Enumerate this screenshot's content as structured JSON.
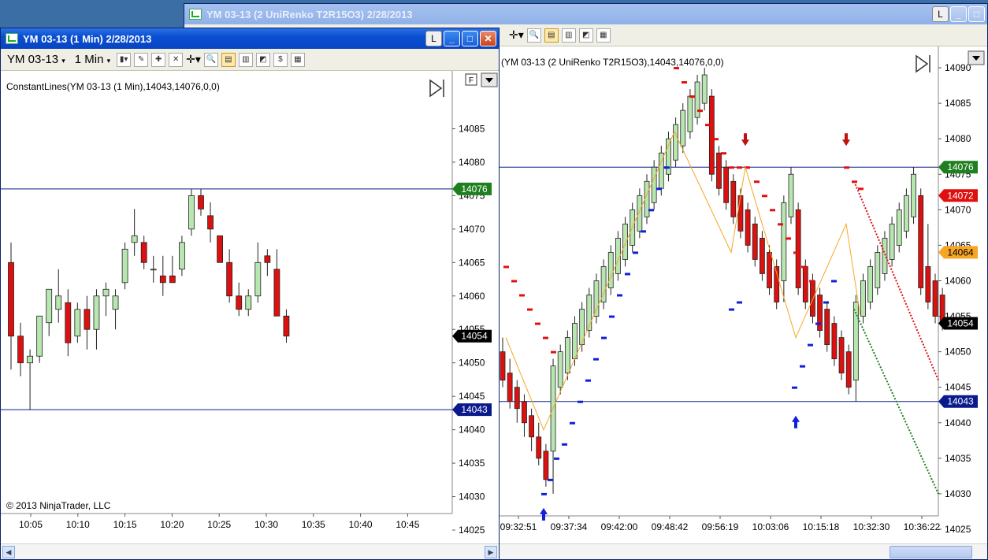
{
  "right_window": {
    "title": "YM 03-13 (2 UniRenko T2R15O3)  2/28/2013",
    "indicator_label": "(YM  03-13  (2  UniRenko  T2R15O3),14043,14076,0,0)",
    "y_ticks": [
      "14090",
      "14085",
      "14080",
      "14075",
      "14070",
      "14065",
      "14060",
      "14055",
      "14050",
      "14045",
      "14040",
      "14035",
      "14030",
      "14025"
    ],
    "x_ticks": [
      "09:32:51",
      "09:37:34",
      "09:42:00",
      "09:48:42",
      "09:56:19",
      "10:03:06",
      "10:15:18",
      "10:32:30",
      "10:36:22"
    ],
    "price_tags": [
      {
        "label": "14076",
        "value": 14076,
        "color": "#1e7f1e"
      },
      {
        "label": "14072",
        "value": 14072,
        "color": "#e01010"
      },
      {
        "label": "14064",
        "value": 14064,
        "color": "#f6a623"
      },
      {
        "label": "14054",
        "value": 14054,
        "color": "#000000"
      },
      {
        "label": "14043",
        "value": 14043,
        "color": "#0a1a8c"
      }
    ]
  },
  "left_window": {
    "title": "YM 03-13 (1 Min)  2/28/2013",
    "instrument": "YM 03-13",
    "interval": "1 Min",
    "indicator_label": "ConstantLines(YM  03-13  (1  Min),14043,14076,0,0)",
    "copyright": "© 2013 NinjaTrader, LLC",
    "y_ticks": [
      "14085",
      "14080",
      "14075",
      "14070",
      "14065",
      "14060",
      "14055",
      "14050",
      "14045",
      "14040",
      "14035",
      "14030",
      "14025"
    ],
    "x_ticks": [
      "10:05",
      "10:10",
      "10:15",
      "10:20",
      "10:25",
      "10:30",
      "10:35",
      "10:40",
      "10:45"
    ],
    "price_tags": [
      {
        "label": "14076",
        "value": 14076,
        "color": "#1e7f1e"
      },
      {
        "label": "14054",
        "value": 14054,
        "color": "#000000"
      },
      {
        "label": "14043",
        "value": 14043,
        "color": "#0a1a8c"
      }
    ]
  },
  "window_buttons": {
    "lock": "L",
    "minimize": "_",
    "maximize": "□",
    "close": "✕"
  },
  "chart_data": [
    {
      "type": "candlestick",
      "id": "left-1min",
      "ylim": [
        14023,
        14092
      ],
      "constant_lines": [
        14043,
        14076
      ],
      "candles": [
        {
          "o": 14065,
          "h": 14068,
          "l": 14049,
          "c": 14054
        },
        {
          "o": 14054,
          "h": 14056,
          "l": 14048,
          "c": 14050
        },
        {
          "o": 14050,
          "h": 14052,
          "l": 14043,
          "c": 14051
        },
        {
          "o": 14051,
          "h": 14057,
          "l": 14050,
          "c": 14057
        },
        {
          "o": 14056,
          "h": 14061,
          "l": 14054,
          "c": 14061
        },
        {
          "o": 14058,
          "h": 14064,
          "l": 14056,
          "c": 14060
        },
        {
          "o": 14059,
          "h": 14061,
          "l": 14051,
          "c": 14053
        },
        {
          "o": 14054,
          "h": 14059,
          "l": 14053,
          "c": 14058
        },
        {
          "o": 14058,
          "h": 14060,
          "l": 14052,
          "c": 14055
        },
        {
          "o": 14055,
          "h": 14061,
          "l": 14052,
          "c": 14060
        },
        {
          "o": 14060,
          "h": 14062,
          "l": 14057,
          "c": 14061
        },
        {
          "o": 14058,
          "h": 14061,
          "l": 14055,
          "c": 14060
        },
        {
          "o": 14062,
          "h": 14068,
          "l": 14061,
          "c": 14067
        },
        {
          "o": 14068,
          "h": 14073,
          "l": 14066,
          "c": 14069
        },
        {
          "o": 14068,
          "h": 14069,
          "l": 14064,
          "c": 14065
        },
        {
          "o": 14064,
          "h": 14066,
          "l": 14062,
          "c": 14064
        },
        {
          "o": 14063,
          "h": 14066,
          "l": 14060,
          "c": 14062
        },
        {
          "o": 14063,
          "h": 14066,
          "l": 14062,
          "c": 14062
        },
        {
          "o": 14064,
          "h": 14069,
          "l": 14063,
          "c": 14068
        },
        {
          "o": 14070,
          "h": 14076,
          "l": 14069,
          "c": 14075
        },
        {
          "o": 14075,
          "h": 14076,
          "l": 14072,
          "c": 14073
        },
        {
          "o": 14072,
          "h": 14074,
          "l": 14068,
          "c": 14070
        },
        {
          "o": 14069,
          "h": 14069,
          "l": 14065,
          "c": 14065
        },
        {
          "o": 14065,
          "h": 14067,
          "l": 14059,
          "c": 14060
        },
        {
          "o": 14060,
          "h": 14062,
          "l": 14057,
          "c": 14058
        },
        {
          "o": 14058,
          "h": 14061,
          "l": 14057,
          "c": 14060
        },
        {
          "o": 14060,
          "h": 14068,
          "l": 14059,
          "c": 14065
        },
        {
          "o": 14066,
          "h": 14067,
          "l": 14063,
          "c": 14065
        },
        {
          "o": 14064,
          "h": 14067,
          "l": 14057,
          "c": 14057
        },
        {
          "o": 14057,
          "h": 14058,
          "l": 14053,
          "c": 14054
        }
      ]
    },
    {
      "type": "candlestick",
      "id": "right-unirenko",
      "ylim": [
        14023,
        14093
      ],
      "constant_lines": [
        14043,
        14076
      ],
      "candles": [
        {
          "o": 14050,
          "h": 14052,
          "l": 14045,
          "c": 14046
        },
        {
          "o": 14047,
          "h": 14049,
          "l": 14042,
          "c": 14043
        },
        {
          "o": 14045,
          "h": 14046,
          "l": 14040,
          "c": 14042
        },
        {
          "o": 14043,
          "h": 14044,
          "l": 14038,
          "c": 14040
        },
        {
          "o": 14041,
          "h": 14042,
          "l": 14036,
          "c": 14038
        },
        {
          "o": 14038,
          "h": 14040,
          "l": 14034,
          "c": 14035
        },
        {
          "o": 14036,
          "h": 14037,
          "l": 14031,
          "c": 14032
        },
        {
          "o": 14036,
          "h": 14049,
          "l": 14030,
          "c": 14048
        },
        {
          "o": 14045,
          "h": 14051,
          "l": 14044,
          "c": 14050
        },
        {
          "o": 14047,
          "h": 14053,
          "l": 14046,
          "c": 14052
        },
        {
          "o": 14049,
          "h": 14055,
          "l": 14048,
          "c": 14054
        },
        {
          "o": 14051,
          "h": 14057,
          "l": 14050,
          "c": 14056
        },
        {
          "o": 14053,
          "h": 14059,
          "l": 14052,
          "c": 14058
        },
        {
          "o": 14055,
          "h": 14061,
          "l": 14054,
          "c": 14060
        },
        {
          "o": 14057,
          "h": 14063,
          "l": 14056,
          "c": 14062
        },
        {
          "o": 14059,
          "h": 14065,
          "l": 14058,
          "c": 14064
        },
        {
          "o": 14061,
          "h": 14067,
          "l": 14060,
          "c": 14066
        },
        {
          "o": 14063,
          "h": 14069,
          "l": 14062,
          "c": 14068
        },
        {
          "o": 14065,
          "h": 14071,
          "l": 14064,
          "c": 14070
        },
        {
          "o": 14067,
          "h": 14073,
          "l": 14066,
          "c": 14072
        },
        {
          "o": 14069,
          "h": 14075,
          "l": 14068,
          "c": 14074
        },
        {
          "o": 14071,
          "h": 14077,
          "l": 14070,
          "c": 14076
        },
        {
          "o": 14073,
          "h": 14079,
          "l": 14072,
          "c": 14078
        },
        {
          "o": 14075,
          "h": 14081,
          "l": 14074,
          "c": 14080
        },
        {
          "o": 14077,
          "h": 14083,
          "l": 14076,
          "c": 14082
        },
        {
          "o": 14079,
          "h": 14085,
          "l": 14078,
          "c": 14084
        },
        {
          "o": 14081,
          "h": 14087,
          "l": 14080,
          "c": 14086
        },
        {
          "o": 14083,
          "h": 14089,
          "l": 14082,
          "c": 14088
        },
        {
          "o": 14085,
          "h": 14090,
          "l": 14084,
          "c": 14089
        },
        {
          "o": 14086,
          "h": 14087,
          "l": 14074,
          "c": 14075
        },
        {
          "o": 14078,
          "h": 14079,
          "l": 14072,
          "c": 14073
        },
        {
          "o": 14076,
          "h": 14077,
          "l": 14070,
          "c": 14071
        },
        {
          "o": 14074,
          "h": 14075,
          "l": 14068,
          "c": 14069
        },
        {
          "o": 14072,
          "h": 14073,
          "l": 14066,
          "c": 14067
        },
        {
          "o": 14070,
          "h": 14071,
          "l": 14064,
          "c": 14065
        },
        {
          "o": 14068,
          "h": 14069,
          "l": 14062,
          "c": 14063
        },
        {
          "o": 14066,
          "h": 14067,
          "l": 14060,
          "c": 14061
        },
        {
          "o": 14064,
          "h": 14065,
          "l": 14058,
          "c": 14059
        },
        {
          "o": 14062,
          "h": 14063,
          "l": 14056,
          "c": 14057
        },
        {
          "o": 14060,
          "h": 14072,
          "l": 14057,
          "c": 14071
        },
        {
          "o": 14069,
          "h": 14076,
          "l": 14068,
          "c": 14075
        },
        {
          "o": 14070,
          "h": 14071,
          "l": 14058,
          "c": 14059
        },
        {
          "o": 14062,
          "h": 14063,
          "l": 14056,
          "c": 14057
        },
        {
          "o": 14060,
          "h": 14061,
          "l": 14054,
          "c": 14055
        },
        {
          "o": 14058,
          "h": 14059,
          "l": 14052,
          "c": 14053
        },
        {
          "o": 14056,
          "h": 14057,
          "l": 14050,
          "c": 14051
        },
        {
          "o": 14054,
          "h": 14055,
          "l": 14048,
          "c": 14049
        },
        {
          "o": 14052,
          "h": 14053,
          "l": 14046,
          "c": 14047
        },
        {
          "o": 14050,
          "h": 14051,
          "l": 14044,
          "c": 14045
        },
        {
          "o": 14046,
          "h": 14058,
          "l": 14043,
          "c": 14057
        },
        {
          "o": 14055,
          "h": 14061,
          "l": 14054,
          "c": 14060
        },
        {
          "o": 14057,
          "h": 14063,
          "l": 14056,
          "c": 14062
        },
        {
          "o": 14059,
          "h": 14065,
          "l": 14058,
          "c": 14064
        },
        {
          "o": 14061,
          "h": 14067,
          "l": 14060,
          "c": 14066
        },
        {
          "o": 14063,
          "h": 14069,
          "l": 14062,
          "c": 14068
        },
        {
          "o": 14065,
          "h": 14071,
          "l": 14064,
          "c": 14070
        },
        {
          "o": 14067,
          "h": 14073,
          "l": 14066,
          "c": 14072
        },
        {
          "o": 14069,
          "h": 14076,
          "l": 14068,
          "c": 14075
        },
        {
          "o": 14072,
          "h": 14073,
          "l": 14058,
          "c": 14059
        },
        {
          "o": 14062,
          "h": 14068,
          "l": 14056,
          "c": 14057
        },
        {
          "o": 14060,
          "h": 14061,
          "l": 14054,
          "c": 14055
        },
        {
          "o": 14058,
          "h": 14059,
          "l": 14053,
          "c": 14054
        }
      ]
    }
  ]
}
